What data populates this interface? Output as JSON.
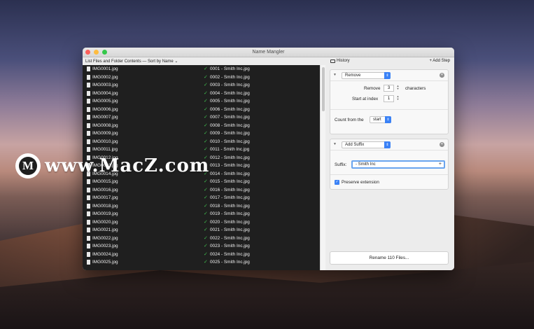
{
  "window": {
    "title": "Name Mangler"
  },
  "toolbar": {
    "list_label": "List Files and Folder Contents — Sort by Name ⌄",
    "history_label": "History",
    "add_step_label": "+ Add Step"
  },
  "files": [
    {
      "name": "IMG0001.jpg",
      "new": "0001 - Smith Inc.jpg"
    },
    {
      "name": "IMG0002.jpg",
      "new": "0002 - Smith Inc.jpg"
    },
    {
      "name": "IMG0003.jpg",
      "new": "0003 - Smith Inc.jpg"
    },
    {
      "name": "IMG0004.jpg",
      "new": "0004 - Smith Inc.jpg"
    },
    {
      "name": "IMG0005.jpg",
      "new": "0005 - Smith Inc.jpg"
    },
    {
      "name": "IMG0006.jpg",
      "new": "0006 - Smith Inc.jpg"
    },
    {
      "name": "IMG0007.jpg",
      "new": "0007 - Smith Inc.jpg"
    },
    {
      "name": "IMG0008.jpg",
      "new": "0008 - Smith Inc.jpg"
    },
    {
      "name": "IMG0009.jpg",
      "new": "0009 - Smith Inc.jpg"
    },
    {
      "name": "IMG0010.jpg",
      "new": "0010 - Smith Inc.jpg"
    },
    {
      "name": "IMG0011.jpg",
      "new": "0011 - Smith Inc.jpg"
    },
    {
      "name": "IMG0012.jpg",
      "new": "0012 - Smith Inc.jpg"
    },
    {
      "name": "IMG0013.jpg",
      "new": "0013 - Smith Inc.jpg"
    },
    {
      "name": "IMG0014.jpg",
      "new": "0014 - Smith Inc.jpg"
    },
    {
      "name": "IMG0015.jpg",
      "new": "0015 - Smith Inc.jpg"
    },
    {
      "name": "IMG0016.jpg",
      "new": "0016 - Smith Inc.jpg"
    },
    {
      "name": "IMG0017.jpg",
      "new": "0017 - Smith Inc.jpg"
    },
    {
      "name": "IMG0018.jpg",
      "new": "0018 - Smith Inc.jpg"
    },
    {
      "name": "IMG0019.jpg",
      "new": "0019 - Smith Inc.jpg"
    },
    {
      "name": "IMG0020.jpg",
      "new": "0020 - Smith Inc.jpg"
    },
    {
      "name": "IMG0021.jpg",
      "new": "0021 - Smith Inc.jpg"
    },
    {
      "name": "IMG0022.jpg",
      "new": "0022 - Smith Inc.jpg"
    },
    {
      "name": "IMG0023.jpg",
      "new": "0023 - Smith Inc.jpg"
    },
    {
      "name": "IMG0024.jpg",
      "new": "0024 - Smith Inc.jpg"
    },
    {
      "name": "IMG0025.jpg",
      "new": "0025 - Smith Inc.jpg"
    }
  ],
  "steps": {
    "remove": {
      "action": "Remove",
      "remove_label": "Remove",
      "remove_value": "3",
      "characters_label": "characters",
      "start_label": "Start at index",
      "start_value": "1",
      "count_from_label": "Count from the",
      "count_from_value": "start"
    },
    "suffix": {
      "action": "Add Suffix",
      "suffix_label": "Suffix:",
      "suffix_value": " - Smith Inc",
      "preserve_label": "Preserve extension",
      "preserve_checked": true
    }
  },
  "rename_button": "Rename 110 Files...",
  "watermark": {
    "logo_letter": "M",
    "text": "www.MacZ.com"
  },
  "colors": {
    "accent": "#3b82f6",
    "check": "#3fbf4e",
    "list_bg": "#1f1f1f"
  }
}
